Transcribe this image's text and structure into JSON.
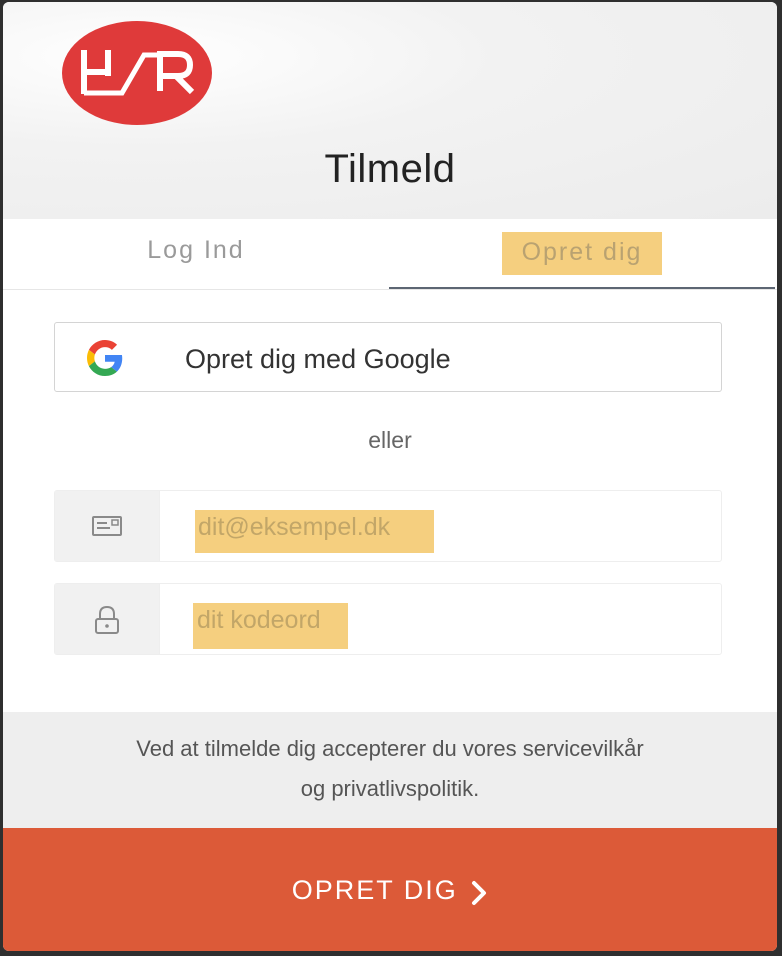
{
  "header": {
    "logo_text": "H/R",
    "title": "Tilmeld"
  },
  "tabs": [
    {
      "label": "Log Ind",
      "active": false
    },
    {
      "label": "Opret dig",
      "active": true
    }
  ],
  "google_button": {
    "label": "Opret dig med Google",
    "icon": "google-icon"
  },
  "separator_text": "eller",
  "email_field": {
    "icon": "envelope-icon",
    "placeholder": "dit@eksempel.dk",
    "value": ""
  },
  "password_field": {
    "icon": "lock-icon",
    "placeholder": "dit kodeord",
    "value": ""
  },
  "terms": {
    "line1": "Ved at tilmelde dig accepterer du vores servicevilkår",
    "line2": "og privatlivspolitik."
  },
  "submit": {
    "label": "OPRET DIG",
    "icon": "chevron-right-icon"
  },
  "colors": {
    "accent": "#dc5a38",
    "logo": "#df3a3a",
    "highlight": "#f5cf7f"
  }
}
